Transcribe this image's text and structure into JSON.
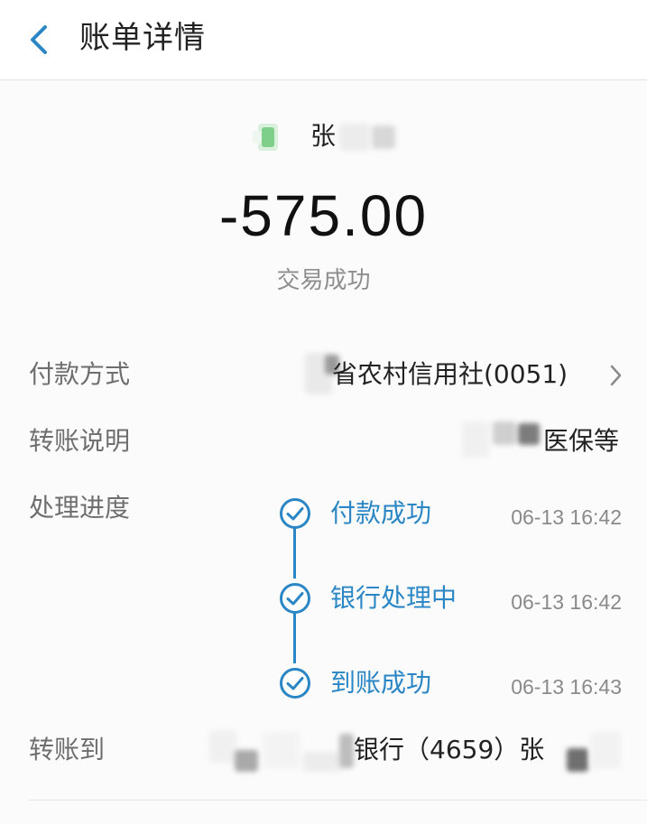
{
  "header": {
    "back_icon": "chevron-left-icon",
    "title": "账单详情"
  },
  "payee": {
    "avatar_icon": "payee-avatar-icon",
    "name_visible": "张"
  },
  "amount": "-575.00",
  "status": "交易成功",
  "details": {
    "payment_method": {
      "label": "付款方式",
      "value": "省农村信用社(0051)",
      "chevron_icon": "chevron-right-icon"
    },
    "transfer_note": {
      "label": "转账说明",
      "value": "医保等"
    },
    "progress": {
      "label": "处理进度",
      "steps": [
        {
          "label": "付款成功",
          "time": "06-13 16:42"
        },
        {
          "label": "银行处理中",
          "time": "06-13 16:42"
        },
        {
          "label": "到账成功",
          "time": "06-13 16:43"
        }
      ],
      "step_icon": "check-circle-icon"
    },
    "transfer_to": {
      "label": "转账到",
      "value": "银行（4659）张"
    }
  },
  "colors": {
    "accent": "#2a86c4",
    "label": "#6e6e6e",
    "muted": "#8e8e8e"
  }
}
